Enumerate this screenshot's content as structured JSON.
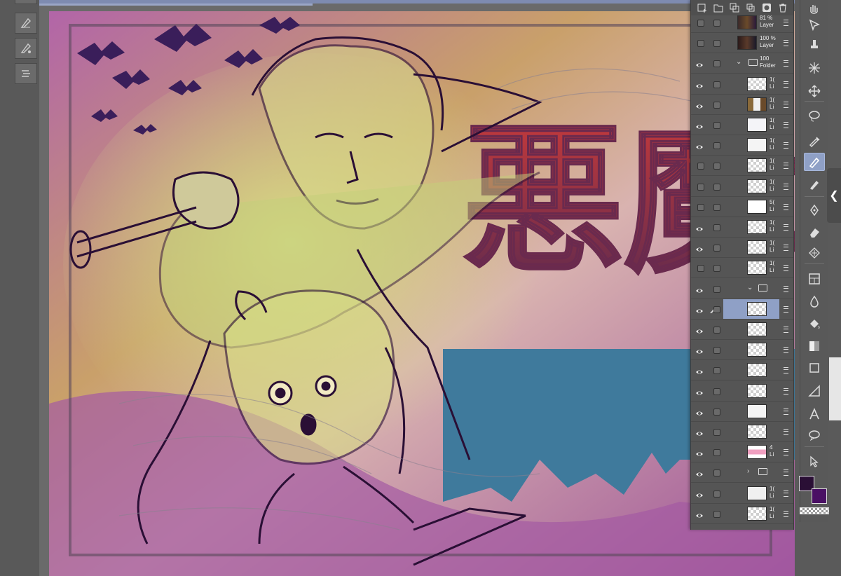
{
  "colors": {
    "ui_dark": "#555555",
    "accent": "#8fa0c6",
    "main_color": "#2a0f35",
    "sub_color": "#4a1064",
    "title_top": "#c83a3a",
    "title_bottom": "#6a2a4e",
    "bg_purple": "#9b5a9c",
    "bg_blue": "#3f7a9c"
  },
  "left_tools": [
    "pen-sub-tool-1",
    "pen-sub-tool-2",
    "pen-sub-tool-3"
  ],
  "layer_toolbar": [
    "new-raster-layer-icon",
    "new-folder-icon",
    "copy-layer-icon",
    "merge-icon",
    "mask-icon",
    "delete-icon"
  ],
  "layers": [
    {
      "name": "Layer",
      "pct": "81 %",
      "type": "layer",
      "visible": false,
      "thumb": "dark"
    },
    {
      "name": "Layer",
      "pct": "100 %",
      "type": "layer",
      "visible": false,
      "thumb": "dark2"
    },
    {
      "name": "Folder",
      "pct": "100",
      "type": "folder",
      "visible": true
    },
    {
      "name": "Li",
      "pct": "1(",
      "type": "layer",
      "visible": true,
      "thumb": "checker"
    },
    {
      "name": "Li",
      "pct": "1(",
      "type": "layer",
      "visible": true,
      "thumb": "bars"
    },
    {
      "name": "Li",
      "pct": "1(",
      "type": "layer",
      "visible": true,
      "thumb": "sketch"
    },
    {
      "name": "Li",
      "pct": "1(",
      "type": "layer",
      "visible": true,
      "thumb": "redsketch"
    },
    {
      "name": "Li",
      "pct": "1(",
      "type": "layer",
      "visible": false,
      "thumb": "checker"
    },
    {
      "name": "Li",
      "pct": "1(",
      "type": "layer",
      "visible": false,
      "thumb": "checker"
    },
    {
      "name": "Li",
      "pct": "5(",
      "type": "layer",
      "visible": false,
      "thumb": "white"
    },
    {
      "name": "Li",
      "pct": "1(",
      "type": "layer",
      "visible": true,
      "thumb": "checker"
    },
    {
      "name": "Li",
      "pct": "1(",
      "type": "layer",
      "visible": true,
      "thumb": "checker"
    },
    {
      "name": "Li",
      "pct": "1(",
      "type": "layer",
      "visible": false,
      "thumb": "checker"
    },
    {
      "name": "",
      "pct": "",
      "type": "folder",
      "visible": true
    },
    {
      "name": "",
      "pct": "",
      "type": "layer",
      "visible": true,
      "selected": true,
      "thumb": "checker"
    },
    {
      "name": "",
      "pct": "",
      "type": "layer",
      "visible": true,
      "thumb": "checker"
    },
    {
      "name": "",
      "pct": "",
      "type": "layer",
      "visible": true,
      "thumb": "checker"
    },
    {
      "name": "",
      "pct": "",
      "type": "layer",
      "visible": true,
      "thumb": "checker"
    },
    {
      "name": "",
      "pct": "",
      "type": "layer",
      "visible": true,
      "thumb": "checker"
    },
    {
      "name": "",
      "pct": "",
      "type": "layer",
      "visible": true,
      "thumb": "sketch2"
    },
    {
      "name": "",
      "pct": "",
      "type": "layer",
      "visible": true,
      "thumb": "checker"
    },
    {
      "name": "Li",
      "pct": "4",
      "type": "layer",
      "visible": true,
      "thumb": "pink"
    },
    {
      "name": "",
      "pct": "",
      "type": "folder",
      "visible": true,
      "collapsed": true
    },
    {
      "name": "Li",
      "pct": "1(",
      "type": "layer",
      "visible": true,
      "thumb": "green"
    },
    {
      "name": "Li",
      "pct": "1(",
      "type": "layer",
      "visible": true,
      "thumb": "checker"
    }
  ],
  "tools": [
    "hand-icon",
    "object-select-icon",
    "stamp-icon",
    "auto-select-icon",
    "move-icon",
    "lasso-icon",
    "eyedropper-icon",
    "pen-icon",
    "pencil-icon",
    "ink-pen-icon",
    "eraser-icon",
    "blend-icon",
    "frame-icon",
    "fill-drop-icon",
    "bucket-icon",
    "gradient-icon",
    "rectangle-icon",
    "ruler-icon",
    "text-icon",
    "balloon-icon",
    "select-arrow-icon"
  ],
  "title_glyphs": "悪魔城"
}
